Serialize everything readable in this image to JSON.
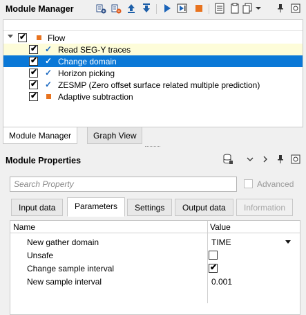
{
  "module_manager": {
    "title": "Module Manager",
    "toolbar_icons": [
      "add-module-icon",
      "remove-module-icon",
      "move-up-icon",
      "move-down-icon",
      "run-icon",
      "run-step-icon",
      "stop-icon",
      "notes-icon",
      "clipboard-icon",
      "copy-icon",
      "dropdown-icon",
      "pin-icon",
      "maximize-icon"
    ]
  },
  "flow": {
    "root_label": "Flow",
    "items": [
      {
        "label": "Read SEG-Y traces",
        "checked": true,
        "status": "done"
      },
      {
        "label": "Change domain",
        "checked": true,
        "status": "done"
      },
      {
        "label": "Horizon picking",
        "checked": true,
        "status": "done"
      },
      {
        "label": "ZESMP  (Zero offset surface related multiple prediction)",
        "checked": true,
        "status": "done"
      },
      {
        "label": "Adaptive subtraction",
        "checked": true,
        "status": "pending"
      }
    ]
  },
  "bottom_tabs": [
    {
      "label": "Module Manager",
      "active": true
    },
    {
      "label": "Graph View",
      "active": false
    }
  ],
  "module_properties": {
    "title": "Module Properties",
    "search_placeholder": "Search Property",
    "advanced_label": "Advanced",
    "tabs": [
      {
        "label": "Input data"
      },
      {
        "label": "Parameters"
      },
      {
        "label": "Settings"
      },
      {
        "label": "Output data"
      },
      {
        "label": "Information"
      }
    ],
    "grid": {
      "col_name": "Name",
      "col_value": "Value",
      "rows": [
        {
          "name": "New gather domain",
          "value": "TIME"
        },
        {
          "name": "Unsafe",
          "value": ""
        },
        {
          "name": "Change sample interval",
          "value": ""
        },
        {
          "name": "New sample interval",
          "value": "0.001"
        }
      ]
    }
  },
  "colors": {
    "selection": "#0a78d7",
    "highlight_yellow": "#fdfcd9",
    "status_orange": "#e8731f",
    "done_check": "#1867c0"
  }
}
